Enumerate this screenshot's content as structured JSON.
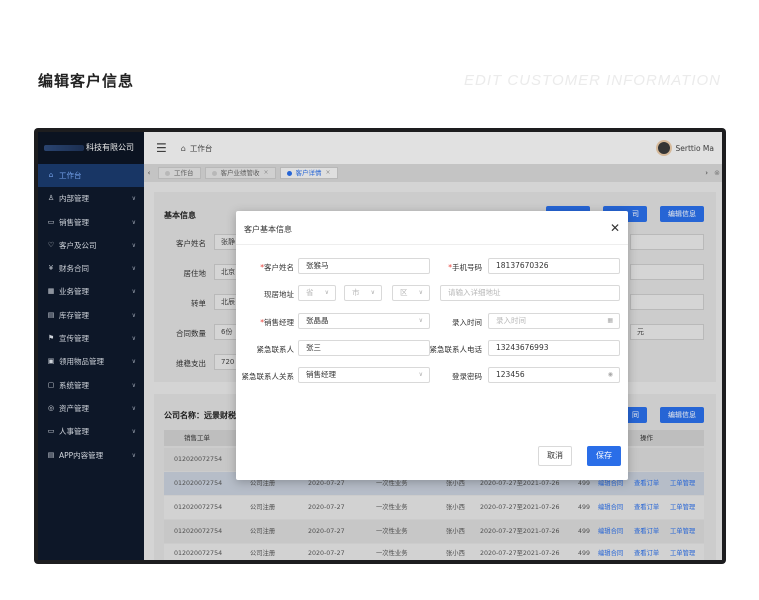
{
  "header": {
    "title": "编辑客户信息",
    "subtitle": "EDIT CUSTOMER INFORMATION"
  },
  "sidebar": {
    "brand": "科技有限公司",
    "items": [
      {
        "label": "工作台",
        "icon": "home-icon"
      },
      {
        "label": "内部管理",
        "icon": "user-icon"
      },
      {
        "label": "销售管理",
        "icon": "folder-icon"
      },
      {
        "label": "客户及公司",
        "icon": "heart-icon"
      },
      {
        "label": "财务合同",
        "icon": "yen-icon"
      },
      {
        "label": "业务管理",
        "icon": "calendar-icon"
      },
      {
        "label": "库存管理",
        "icon": "inbox-icon"
      },
      {
        "label": "宣传管理",
        "icon": "flag-icon"
      },
      {
        "label": "领用物品管理",
        "icon": "box-icon"
      },
      {
        "label": "系统管理",
        "icon": "monitor-icon"
      },
      {
        "label": "资产管理",
        "icon": "target-icon"
      },
      {
        "label": "人事管理",
        "icon": "id-icon"
      },
      {
        "label": "APP内容管理",
        "icon": "doc-icon"
      }
    ]
  },
  "topbar": {
    "home_label": "工作台",
    "user_name": "Serttio Ma"
  },
  "tabs": [
    {
      "label": "工作台"
    },
    {
      "label": "客户业绩管收"
    },
    {
      "label": "客户详情"
    }
  ],
  "background": {
    "basic_info_title": "基本信息",
    "edit_button": "编辑信息",
    "partial_button": "司",
    "partial_button2": "同",
    "fields": [
      {
        "label": "客户姓名",
        "value": "张静"
      },
      {
        "label": "居住地",
        "value": "北京"
      },
      {
        "label": "转单",
        "value": "北辰"
      },
      {
        "label": "合同数量",
        "value": "6份"
      },
      {
        "label": "维稳支出",
        "value": "720"
      }
    ],
    "right_partial": "元",
    "company_title": "公司名称：远景财税",
    "table_headers": {
      "sales_order": "销售工单",
      "action": "操作"
    },
    "rows": [
      {
        "order": "012020072754",
        "type": "",
        "date": "",
        "business": "",
        "person": "",
        "range": "",
        "amount": ""
      },
      {
        "order": "012020072754",
        "type": "公司注册",
        "date": "2020-07-27",
        "business": "一次性业务",
        "person": "张小西",
        "range": "2020-07-27至2021-07-26",
        "amount": "499"
      },
      {
        "order": "012020072754",
        "type": "公司注册",
        "date": "2020-07-27",
        "business": "一次性业务",
        "person": "张小西",
        "range": "2020-07-27至2021-07-26",
        "amount": "499"
      },
      {
        "order": "012020072754",
        "type": "公司注册",
        "date": "2020-07-27",
        "business": "一次性业务",
        "person": "张小西",
        "range": "2020-07-27至2021-07-26",
        "amount": "499"
      },
      {
        "order": "012020072754",
        "type": "公司注册",
        "date": "2020-07-27",
        "business": "一次性业务",
        "person": "张小西",
        "range": "2020-07-27至2021-07-26",
        "amount": "499"
      }
    ],
    "row_actions": {
      "edit_contract": "编辑合同",
      "view_order": "查看订单",
      "manage_order": "工单管理"
    }
  },
  "modal": {
    "title": "客户基本信息",
    "customer_name_label": "客户姓名",
    "customer_name": "张猴马",
    "phone_label": "手机号码",
    "phone": "18137670326",
    "address_label": "现居地址",
    "province_placeholder": "省",
    "city_placeholder": "市",
    "district_placeholder": "区",
    "address_placeholder": "请输入详细地址",
    "sales_manager_label": "销售经理",
    "sales_manager": "张晶晶",
    "entry_time_label": "录入时间",
    "entry_time_placeholder": "录入时间",
    "emergency_contact_label": "紧急联系人",
    "emergency_contact": "张三",
    "emergency_phone_label": "紧急联系人电话",
    "emergency_phone": "13243676993",
    "emergency_relation_label": "紧急联系人关系",
    "emergency_relation": "销售经理",
    "password_label": "登录密码",
    "password": "123456",
    "cancel_label": "取消",
    "save_label": "保存"
  },
  "colors": {
    "accent": "#2a6ee8",
    "sidebar_bg": "#0f1a2c",
    "required": "#e8413a"
  }
}
